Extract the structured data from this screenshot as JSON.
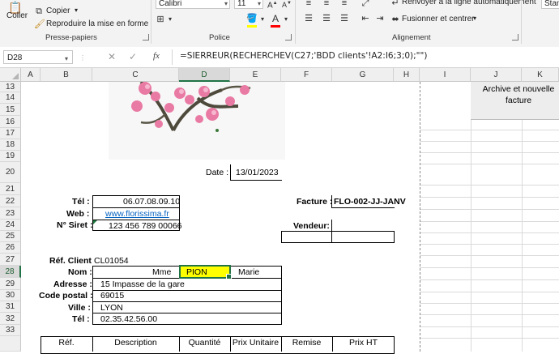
{
  "ribbon": {
    "clipboard": {
      "paste": "Coller",
      "copy": "Copier",
      "format_painter": "Reproduire la mise en forme",
      "group": "Presse-papiers"
    },
    "font": {
      "name": "Calibri",
      "size": "11",
      "group": "Police"
    },
    "alignment": {
      "wrap": "Renvoyer à la ligne automatiquement",
      "merge": "Fusionner et centrer",
      "group": "Alignement"
    },
    "number": {
      "format": "Stan"
    }
  },
  "formula_bar": {
    "name_box": "D28",
    "formula": "=SIERREUR(RECHERCHEV(C27;'BDD clients'!A2:I6;3;0);\"\")"
  },
  "columns": [
    "A",
    "B",
    "C",
    "D",
    "E",
    "F",
    "G",
    "H",
    "I",
    "J",
    "K"
  ],
  "rows": [
    "13",
    "14",
    "15",
    "16",
    "17",
    "18",
    "19",
    "20",
    "21",
    "22",
    "23",
    "24",
    "25",
    "26",
    "27",
    "28",
    "29",
    "30",
    "31",
    "32",
    "33"
  ],
  "cells": {
    "archive_button": "Archive et nouvelle facture",
    "date_label": "Date :",
    "date_value": "13/01/2023",
    "tel_label": "Tél :",
    "tel_value": "06.07.08.09.10",
    "web_label": "Web :",
    "web_value": "www.florissima.fr",
    "siret_label": "N° Siret :",
    "siret_value": "123 456 789 00066",
    "facture_label": "Facture :",
    "facture_value": "FLO-002-JJ-JANV",
    "vendeur_label": "Vendeur:",
    "ref_client_label": "Réf. Client",
    "ref_client_value": "CL01054",
    "nom_label": "Nom :",
    "civilite": "Mme",
    "nom_value": "PION",
    "prenom": "Marie",
    "adresse_label": "Adresse :",
    "adresse_value": "15 Impasse de la gare",
    "cp_label": "Code postal :",
    "cp_value": "69015",
    "ville_label": "Ville :",
    "ville_value": "LYON",
    "tel2_label": "Tél :",
    "tel2_value": "02.35.42.56.00"
  },
  "table_headers": [
    "Réf.",
    "Description",
    "Quantité",
    "Prix Unitaire",
    "Remise",
    "Prix HT"
  ],
  "colors": {
    "selection": "#217346",
    "highlight": "#ffff00",
    "link": "#0563c1"
  }
}
